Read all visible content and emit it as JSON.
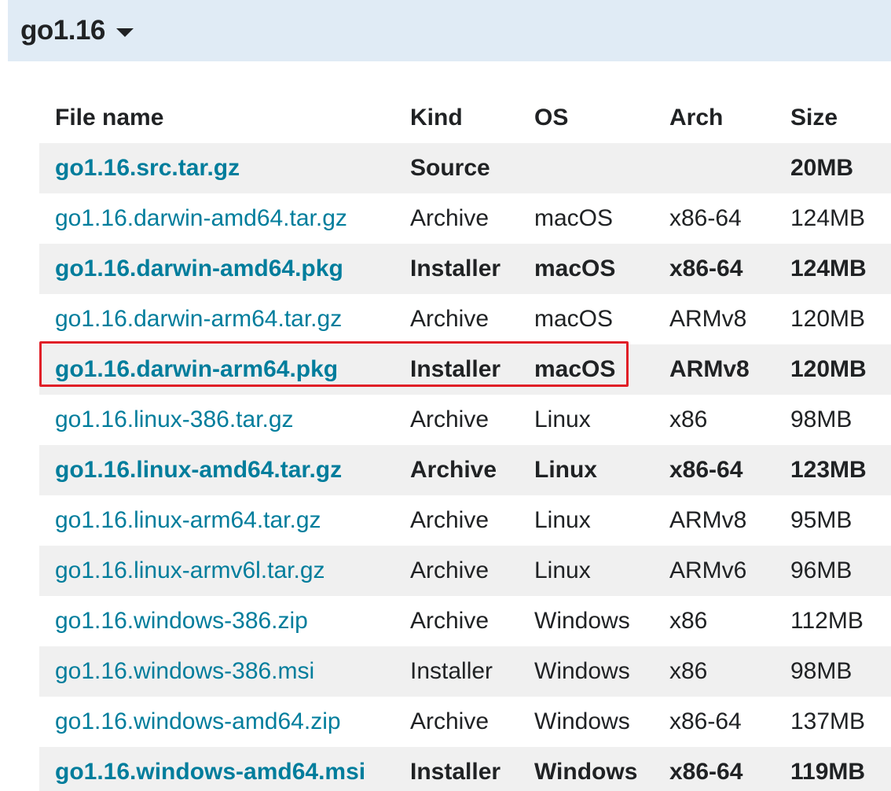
{
  "version_header": {
    "title": "go1.16",
    "toggle_icon": "caret-down-icon"
  },
  "table": {
    "headers": {
      "file": "File name",
      "kind": "Kind",
      "os": "OS",
      "arch": "Arch",
      "size": "Size"
    },
    "rows": [
      {
        "file": "go1.16.src.tar.gz",
        "kind": "Source",
        "os": "",
        "arch": "",
        "size": "20MB",
        "featured": true
      },
      {
        "file": "go1.16.darwin-amd64.tar.gz",
        "kind": "Archive",
        "os": "macOS",
        "arch": "x86-64",
        "size": "124MB",
        "featured": false
      },
      {
        "file": "go1.16.darwin-amd64.pkg",
        "kind": "Installer",
        "os": "macOS",
        "arch": "x86-64",
        "size": "124MB",
        "featured": true
      },
      {
        "file": "go1.16.darwin-arm64.tar.gz",
        "kind": "Archive",
        "os": "macOS",
        "arch": "ARMv8",
        "size": "120MB",
        "featured": false
      },
      {
        "file": "go1.16.darwin-arm64.pkg",
        "kind": "Installer",
        "os": "macOS",
        "arch": "ARMv8",
        "size": "120MB",
        "featured": true
      },
      {
        "file": "go1.16.linux-386.tar.gz",
        "kind": "Archive",
        "os": "Linux",
        "arch": "x86",
        "size": "98MB",
        "featured": false
      },
      {
        "file": "go1.16.linux-amd64.tar.gz",
        "kind": "Archive",
        "os": "Linux",
        "arch": "x86-64",
        "size": "123MB",
        "featured": true
      },
      {
        "file": "go1.16.linux-arm64.tar.gz",
        "kind": "Archive",
        "os": "Linux",
        "arch": "ARMv8",
        "size": "95MB",
        "featured": false
      },
      {
        "file": "go1.16.linux-armv6l.tar.gz",
        "kind": "Archive",
        "os": "Linux",
        "arch": "ARMv6",
        "size": "96MB",
        "featured": false
      },
      {
        "file": "go1.16.windows-386.zip",
        "kind": "Archive",
        "os": "Windows",
        "arch": "x86",
        "size": "112MB",
        "featured": false
      },
      {
        "file": "go1.16.windows-386.msi",
        "kind": "Installer",
        "os": "Windows",
        "arch": "x86",
        "size": "98MB",
        "featured": false
      },
      {
        "file": "go1.16.windows-amd64.zip",
        "kind": "Archive",
        "os": "Windows",
        "arch": "x86-64",
        "size": "137MB",
        "featured": false
      },
      {
        "file": "go1.16.windows-amd64.msi",
        "kind": "Installer",
        "os": "Windows",
        "arch": "x86-64",
        "size": "119MB",
        "featured": true
      }
    ]
  },
  "colors": {
    "header_bg": "#e0ebf5",
    "link": "#007d9c",
    "alt_row_bg": "#f0f0f0",
    "annotation_box": "#e01f27"
  }
}
